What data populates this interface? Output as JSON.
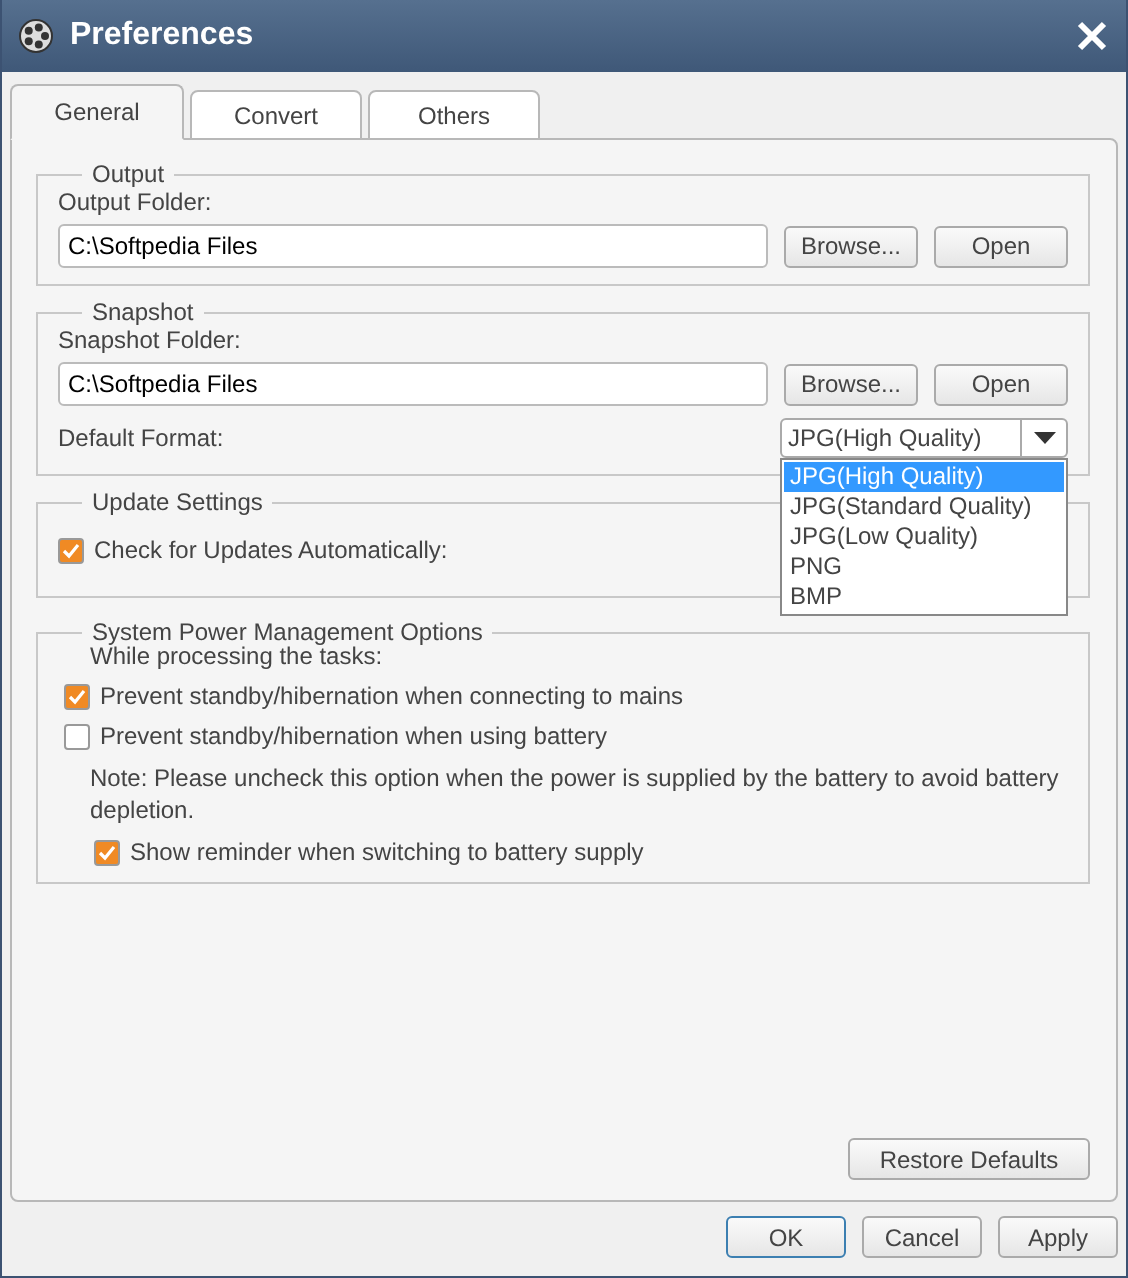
{
  "window": {
    "title": "Preferences"
  },
  "tabs": [
    {
      "label": "General",
      "selected": true
    },
    {
      "label": "Convert",
      "selected": false
    },
    {
      "label": "Others",
      "selected": false
    }
  ],
  "output": {
    "legend": "Output",
    "folder_label": "Output Folder:",
    "folder_value": "C:\\Softpedia Files",
    "browse": "Browse...",
    "open": "Open"
  },
  "snapshot": {
    "legend": "Snapshot",
    "folder_label": "Snapshot Folder:",
    "folder_value": "C:\\Softpedia Files",
    "browse": "Browse...",
    "open": "Open",
    "format_label": "Default Format:",
    "format_value": "JPG(High Quality)",
    "format_open": true,
    "format_options": [
      {
        "label": "JPG(High Quality)",
        "selected": true
      },
      {
        "label": "JPG(Standard Quality)",
        "selected": false
      },
      {
        "label": "JPG(Low Quality)",
        "selected": false
      },
      {
        "label": "PNG",
        "selected": false
      },
      {
        "label": "BMP",
        "selected": false
      }
    ]
  },
  "update": {
    "legend": "Update Settings",
    "options": [
      {
        "label": "Check for Updates Automatically:",
        "checked": true
      }
    ]
  },
  "power": {
    "legend": "System Power Management Options",
    "intro": "While processing the tasks:",
    "items": [
      {
        "kind": "checkbox",
        "label": "Prevent standby/hibernation when connecting to mains",
        "checked": true
      },
      {
        "kind": "checkbox",
        "label": "Prevent standby/hibernation when using battery",
        "checked": false
      },
      {
        "kind": "note",
        "text": "Note: Please uncheck this option when the power is supplied by the battery to avoid battery depletion."
      },
      {
        "kind": "subcheckbox",
        "label": "Show reminder when switching to battery supply",
        "checked": true
      }
    ]
  },
  "restore": "Restore Defaults",
  "buttons": [
    {
      "label": "OK",
      "default": true
    },
    {
      "label": "Cancel",
      "default": false
    },
    {
      "label": "Apply",
      "default": false
    }
  ]
}
